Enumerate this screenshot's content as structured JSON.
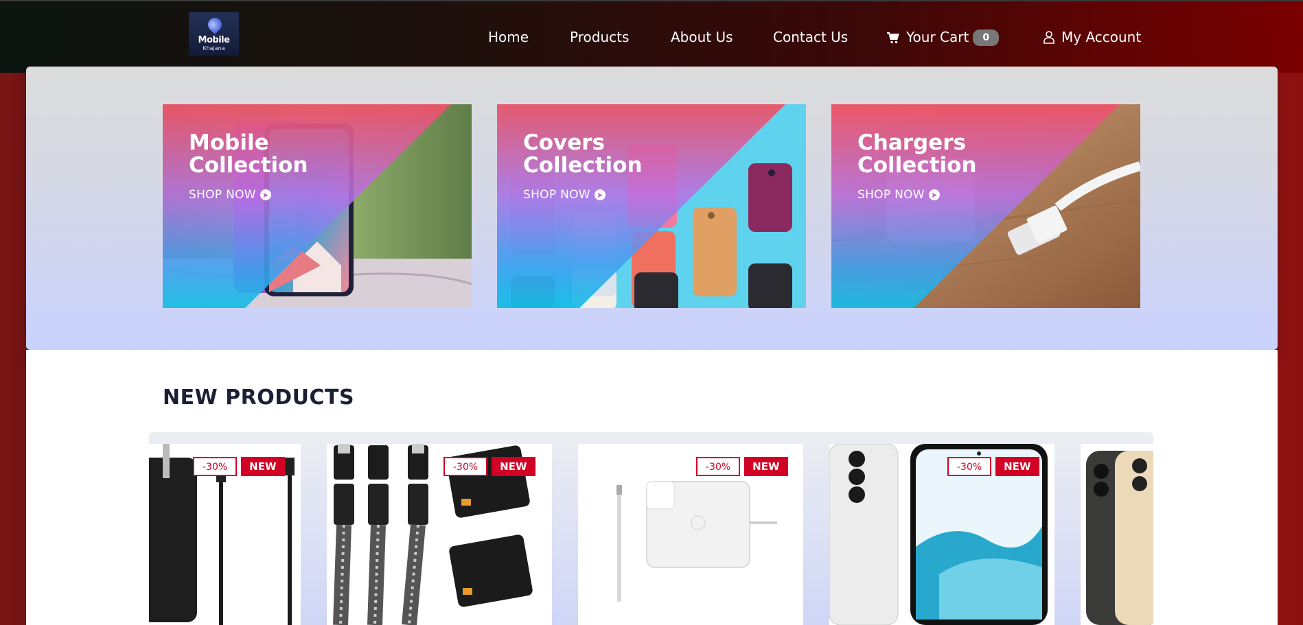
{
  "header": {
    "logo": {
      "line1": "Mobile",
      "line2": "Khajana"
    },
    "nav": [
      {
        "label": "Home"
      },
      {
        "label": "Products"
      },
      {
        "label": "About Us"
      },
      {
        "label": "Contact Us"
      }
    ],
    "cart": {
      "label": "Your Cart",
      "count": "0",
      "icon": "cart-icon"
    },
    "account": {
      "label": "My Account",
      "icon": "user-icon"
    }
  },
  "collections": [
    {
      "title_line1": "Mobile",
      "title_line2": "Collection",
      "cta": "SHOP NOW"
    },
    {
      "title_line1": "Covers",
      "title_line2": "Collection",
      "cta": "SHOP NOW"
    },
    {
      "title_line1": "Chargers",
      "title_line2": "Collection",
      "cta": "SHOP NOW"
    }
  ],
  "new_products": {
    "title": "NEW PRODUCTS",
    "items": [
      {
        "discount": "-30%",
        "tag": "NEW"
      },
      {
        "discount": "-30%",
        "tag": "NEW"
      },
      {
        "discount": "-30%",
        "tag": "NEW"
      },
      {
        "discount": "-30%",
        "tag": "NEW"
      },
      {
        "discount": "",
        "tag": ""
      }
    ]
  },
  "colors": {
    "accent_red": "#d10024",
    "overlay_pink": "#ee5264",
    "overlay_cyan": "#14bee6",
    "heading": "#1c2035"
  }
}
